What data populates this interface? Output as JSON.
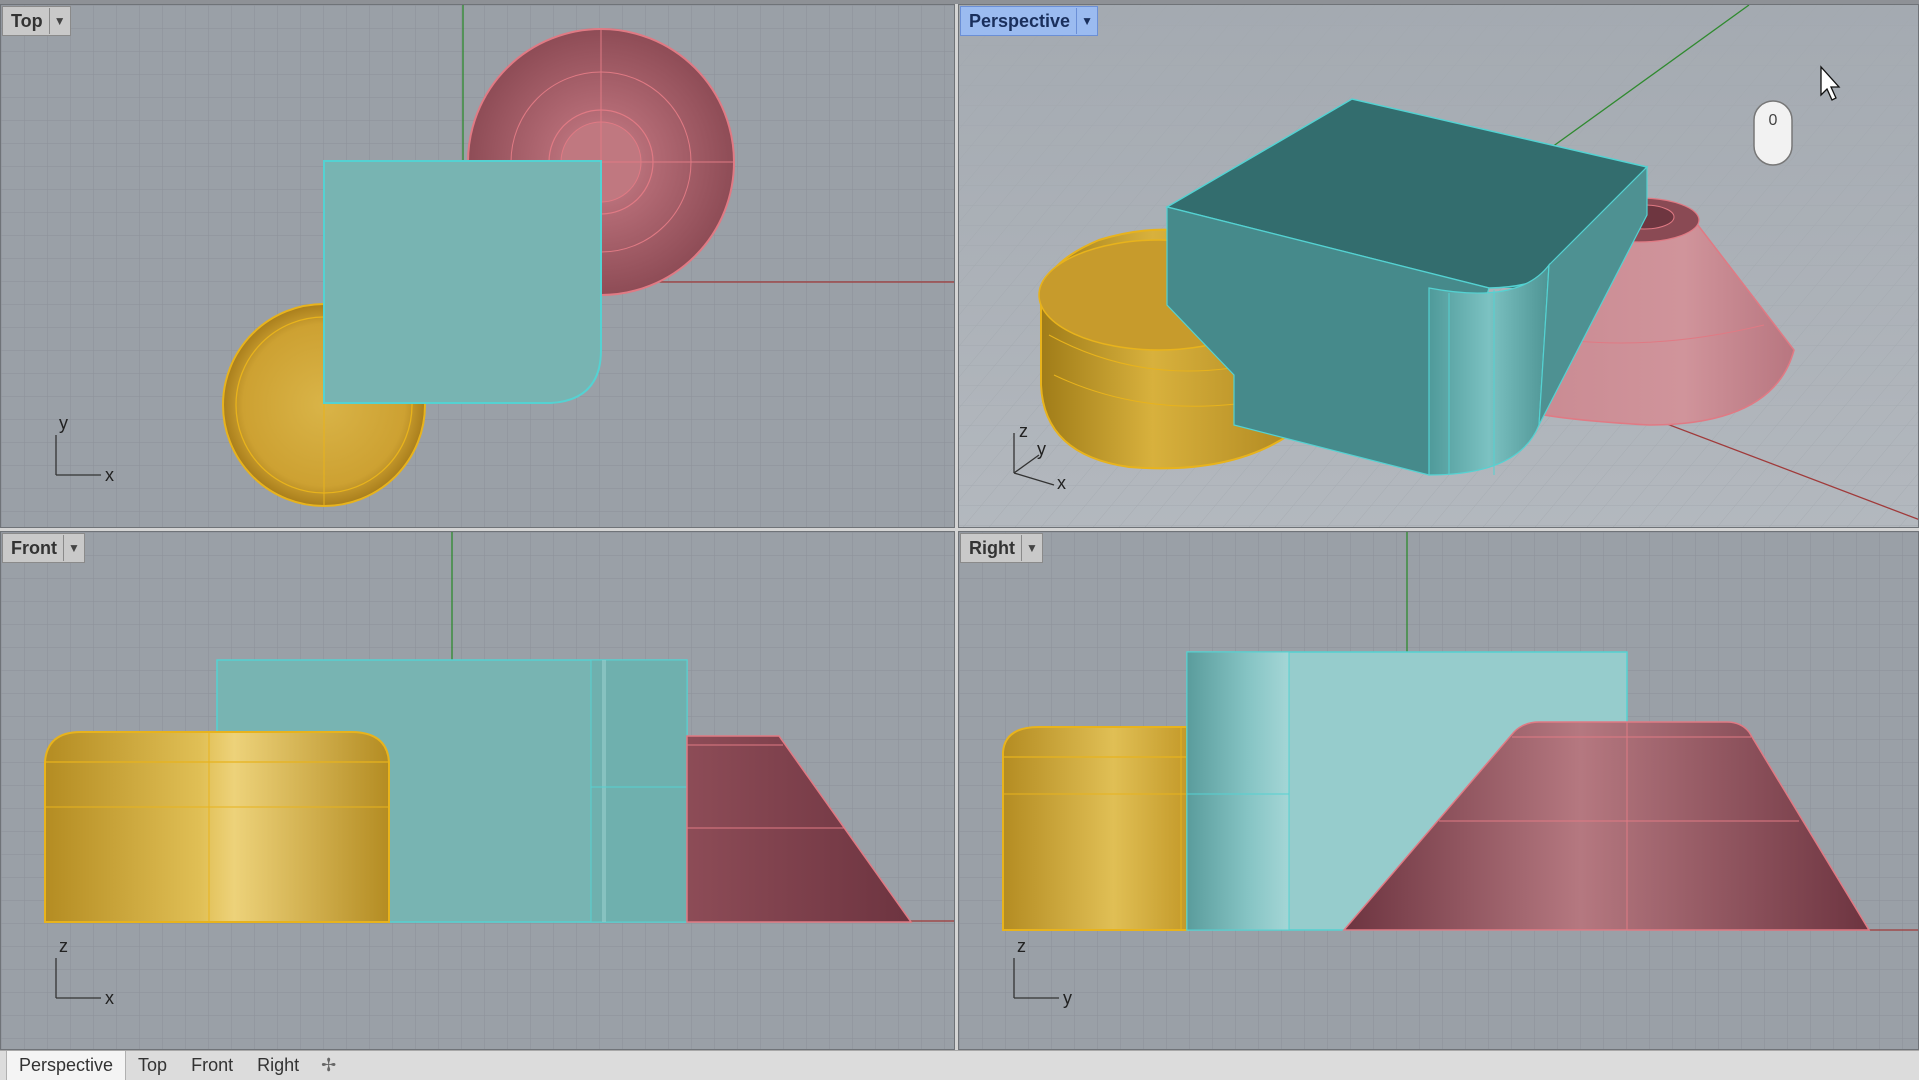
{
  "viewports": {
    "top": {
      "label": "Top",
      "axes": [
        "y",
        "x"
      ]
    },
    "perspective": {
      "label": "Perspective",
      "axes": [
        "z",
        "y",
        "x"
      ],
      "mouse_badge": "0"
    },
    "front": {
      "label": "Front",
      "axes": [
        "z",
        "x"
      ]
    },
    "right": {
      "label": "Right",
      "axes": [
        "z",
        "y"
      ]
    }
  },
  "bottom_tabs": [
    "Perspective",
    "Top",
    "Front",
    "Right"
  ],
  "add_tab_icon": "plus-icon",
  "dropdown_icon": "triangle-down-icon",
  "colors": {
    "viewport_bg": "#9aa0a7",
    "teal": "#78b4b2",
    "teal_edge": "#54d2d2",
    "gold": "#d1aa3c",
    "gold_edge": "#e8b31c",
    "pink": "#b56c76",
    "pink_edge": "#e07a84",
    "active_tab": "#9bbbf0"
  }
}
